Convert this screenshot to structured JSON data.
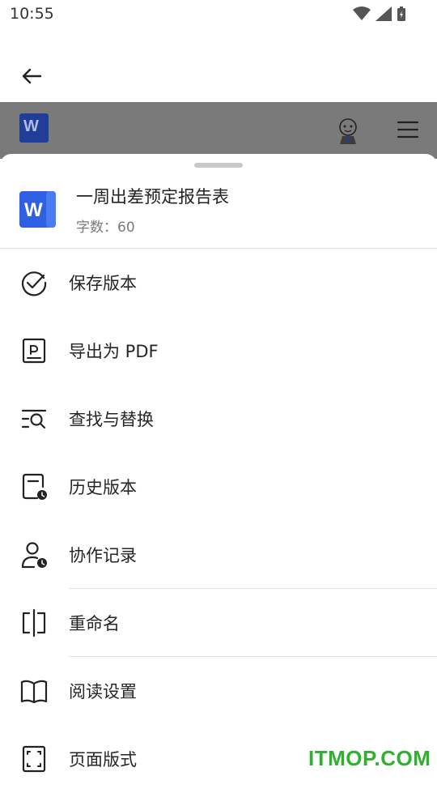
{
  "status_bar": {
    "time": "10:55"
  },
  "toolbar": {
    "logo_letter": "W"
  },
  "document": {
    "title": "一周出差预定报告表",
    "word_count": "字数：60",
    "icon_letter": "W",
    "icon_color": "#2f5fe3"
  },
  "menu": {
    "items": [
      {
        "label": "保存版本",
        "icon": "check-circle-icon"
      },
      {
        "label": "导出为 PDF",
        "icon": "export-pdf-icon"
      },
      {
        "label": "查找与替换",
        "icon": "find-replace-icon"
      },
      {
        "label": "历史版本",
        "icon": "history-icon"
      },
      {
        "label": "协作记录",
        "icon": "collab-record-icon"
      },
      {
        "label": "重命名",
        "icon": "rename-icon"
      },
      {
        "label": "阅读设置",
        "icon": "book-icon"
      },
      {
        "label": "页面版式",
        "icon": "page-layout-icon"
      }
    ]
  },
  "watermark": "ITMOP.COM"
}
